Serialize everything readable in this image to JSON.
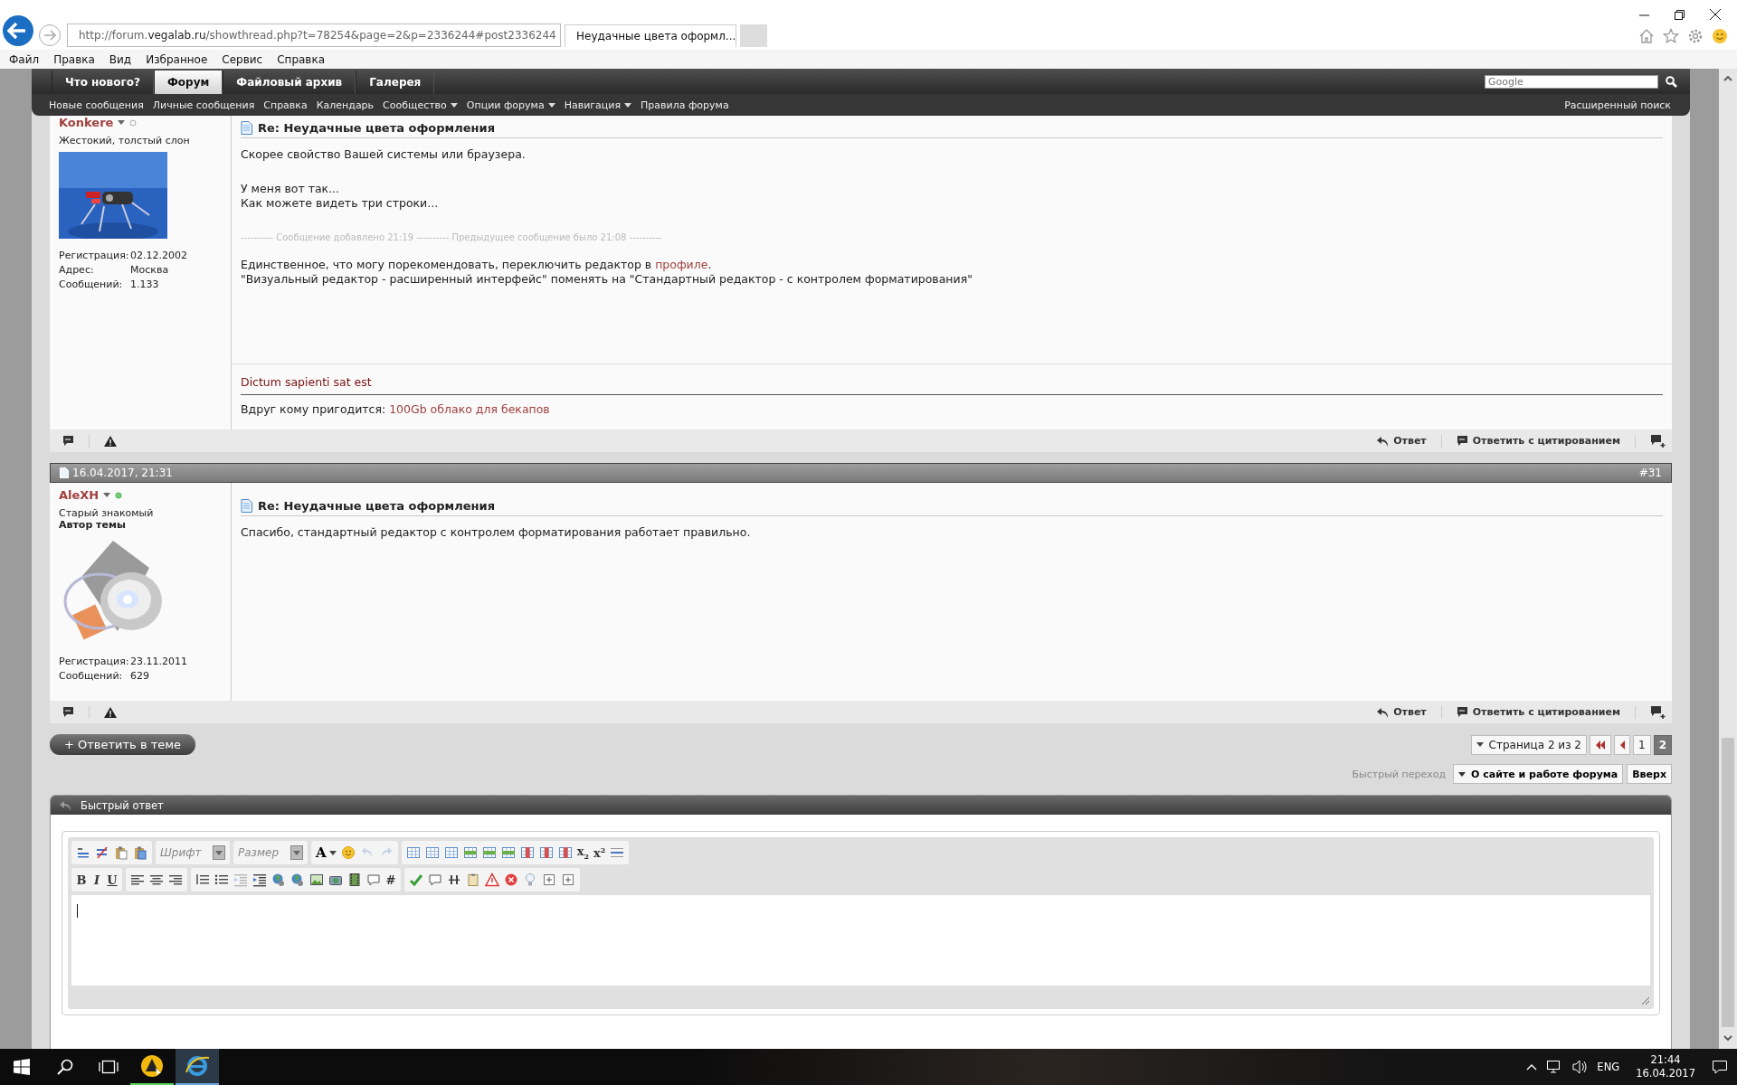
{
  "browser": {
    "address": {
      "prefix": "http://forum.",
      "domain": "vegalab.ru",
      "suffix": "/showthread.php?t=78254&page=2&p=2336244#post2336244"
    },
    "tab": {
      "title": "Неудачные цвета оформл..."
    },
    "menu": [
      "Файл",
      "Правка",
      "Вид",
      "Избранное",
      "Сервис",
      "Справка"
    ]
  },
  "nav": {
    "tabs": [
      {
        "label": "Что нового?",
        "selected": false
      },
      {
        "label": "Форум",
        "selected": true
      },
      {
        "label": "Файловый архив",
        "selected": false
      },
      {
        "label": "Галерея",
        "selected": false
      }
    ],
    "search": {
      "placeholder": "Google"
    },
    "links": [
      {
        "label": "Новые сообщения",
        "dropdown": false
      },
      {
        "label": "Личные сообщения",
        "dropdown": false
      },
      {
        "label": "Справка",
        "dropdown": false
      },
      {
        "label": "Календарь",
        "dropdown": false
      },
      {
        "label": "Сообщество",
        "dropdown": true
      },
      {
        "label": "Опции форума",
        "dropdown": true
      },
      {
        "label": "Навигация",
        "dropdown": true
      },
      {
        "label": "Правила форума",
        "dropdown": false
      }
    ],
    "advanced_search": "Расширенный поиск"
  },
  "posts": [
    {
      "user": {
        "name": "Konkere",
        "online": false,
        "title": "Жестокий, толстый слон",
        "stats": [
          {
            "label": "Регистрация:",
            "value": "02.12.2002"
          },
          {
            "label": "Адрес:",
            "value": "Москва"
          },
          {
            "label": "Сообщений:",
            "value": "1.133"
          }
        ]
      },
      "title": "Re: Неудачные цвета оформления",
      "body": [
        {
          "kind": "text",
          "lines": [
            "Скорее свойство Вашей системы или браузера."
          ]
        },
        {
          "kind": "text",
          "lines": [
            "У меня вот так...",
            "Как можете видеть три строки..."
          ]
        },
        {
          "kind": "notice",
          "lines": [
            "---------- Сообщение добавлено 21:19 ---------- Предыдущее сообщение было 21:08 ----------"
          ]
        },
        {
          "kind": "text",
          "lines": [
            {
              "before": "Единственное, что могу порекомендовать, переключить редактор в ",
              "link": "профиле",
              "after": "."
            },
            "\"Визуальный редактор - расширенный интерфейс\" поменять на \"Стандартный редактор - с контролем форматирования\""
          ]
        }
      ],
      "signature": {
        "motto": "Dictum sapienti sat est",
        "text": "Вдруг кому пригодится: ",
        "link": "100Gb облако для бекапов"
      },
      "footer": {
        "reply": "Ответ",
        "quote": "Ответить с цитированием"
      }
    },
    {
      "date": "16.04.2017, 21:31",
      "number": "#31",
      "user": {
        "name": "AleXH",
        "online": true,
        "title": "Старый знакомый",
        "role": "Автор темы",
        "stats": [
          {
            "label": "Регистрация:",
            "value": "23.11.2011"
          },
          {
            "label": "Сообщений:",
            "value": "629"
          }
        ]
      },
      "title": "Re: Неудачные цвета оформления",
      "body": [
        {
          "kind": "text",
          "lines": [
            "Спасибо, стандартный редактор с контролем форматирования работает правильно."
          ]
        }
      ],
      "footer": {
        "reply": "Ответ",
        "quote": "Ответить с цитированием"
      }
    }
  ],
  "reply_button": "+ Ответить в теме",
  "pager": {
    "label": "Страница 2 из 2",
    "pages": [
      {
        "label": "1",
        "selected": false
      },
      {
        "label": "2",
        "selected": true
      }
    ]
  },
  "quick_nav": {
    "label": "Быстрый переход",
    "forum": "О сайте и работе форума",
    "top": "Вверх"
  },
  "quick_reply": {
    "title": "Быстрый ответ",
    "toolbar": [
      [
        [
          {
            "kind": "icon",
            "disabled": false
          },
          {
            "kind": "icon",
            "disabled": false
          },
          {
            "kind": "icon",
            "disabled": false
          },
          {
            "kind": "icon",
            "disabled": false
          }
        ],
        [
          {
            "kind": "dropdown",
            "placeholder": "Шрифт",
            "disabled": false
          }
        ],
        [
          {
            "kind": "dropdown",
            "placeholder": "Размер",
            "disabled": false
          }
        ],
        [
          {
            "kind": "color",
            "label": "A",
            "disabled": false
          },
          {
            "kind": "icon",
            "disabled": false
          },
          {
            "kind": "icon",
            "disabled": true
          },
          {
            "kind": "icon",
            "disabled": true
          }
        ],
        [
          {
            "kind": "icon",
            "disabled": false
          },
          {
            "kind": "icon",
            "disabled": false
          },
          {
            "kind": "icon",
            "disabled": false
          },
          {
            "kind": "icon",
            "disabled": false
          },
          {
            "kind": "icon",
            "disabled": false
          },
          {
            "kind": "icon",
            "disabled": false
          },
          {
            "kind": "icon",
            "disabled": false
          },
          {
            "kind": "icon",
            "disabled": false
          },
          {
            "kind": "icon",
            "disabled": false
          },
          {
            "kind": "glyph",
            "label": "x$_{2}$",
            "disabled": false
          },
          {
            "kind": "glyph",
            "label": "x$^{2}$",
            "disabled": false
          },
          {
            "kind": "icon",
            "disabled": false
          }
        ]
      ],
      [
        [
          {
            "kind": "bold",
            "label": "B",
            "disabled": false
          },
          {
            "kind": "italic",
            "label": "I",
            "disabled": false
          },
          {
            "kind": "underline",
            "label": "U",
            "disabled": false
          }
        ],
        [
          {
            "kind": "icon",
            "disabled": false
          },
          {
            "kind": "icon",
            "disabled": false
          },
          {
            "kind": "icon",
            "disabled": false
          }
        ],
        [
          {
            "kind": "icon",
            "disabled": false
          },
          {
            "kind": "icon",
            "disabled": false
          },
          {
            "kind": "icon",
            "disabled": true
          },
          {
            "kind": "icon",
            "disabled": false
          },
          {
            "kind": "icon",
            "disabled": false
          },
          {
            "kind": "icon",
            "disabled": false
          },
          {
            "kind": "icon",
            "disabled": false
          },
          {
            "kind": "icon",
            "disabled": false
          },
          {
            "kind": "icon",
            "disabled": false
          },
          {
            "kind": "icon",
            "disabled": false
          },
          {
            "kind": "glyph",
            "label": "#",
            "disabled": false
          }
        ],
        [
          {
            "kind": "icon",
            "disabled": false
          },
          {
            "kind": "icon",
            "disabled": false
          },
          {
            "kind": "icon",
            "disabled": false
          },
          {
            "kind": "icon",
            "disabled": false
          },
          {
            "kind": "icon",
            "disabled": false
          },
          {
            "kind": "icon",
            "disabled": false
          },
          {
            "kind": "icon",
            "disabled": false
          },
          {
            "kind": "icon",
            "disabled": false
          },
          {
            "kind": "icon",
            "disabled": false
          }
        ]
      ]
    ]
  },
  "taskbar": {
    "apps": [
      {
        "kind": "app",
        "selected": false
      },
      {
        "kind": "browser",
        "selected": true
      }
    ],
    "language": "ENG",
    "time": "21:44",
    "date": "16.04.2017"
  }
}
